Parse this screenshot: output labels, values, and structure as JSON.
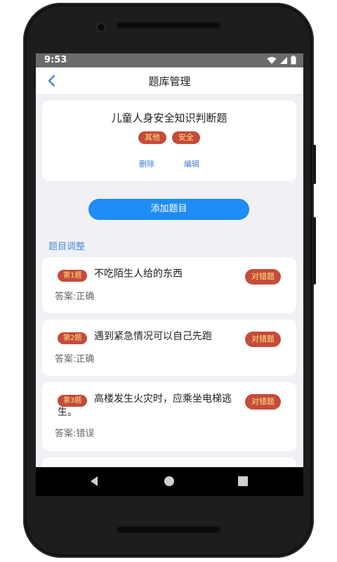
{
  "status_bar": {
    "time": "9:53"
  },
  "navbar": {
    "title": "题库管理"
  },
  "bank": {
    "title": "儿童人身安全知识判断题",
    "tags": [
      "其他",
      "安全"
    ],
    "delete_label": "删除",
    "edit_label": "编辑"
  },
  "add_button_label": "添加题目",
  "section_label": "题目调整",
  "questions": [
    {
      "badge": "第1题",
      "text": "不吃陌生人给的东西",
      "type": "对错题",
      "answer": "答案:正确"
    },
    {
      "badge": "第2题",
      "text": "遇到紧急情况可以自己先跑",
      "type": "对错题",
      "answer": "答案:正确"
    },
    {
      "badge": "第3题",
      "text": "高楼发生火灾时，应乘坐电梯逃生。",
      "type": "对错题",
      "answer": "答案:错误"
    }
  ],
  "colors": {
    "accent": "#1e8cf5",
    "badge_bg": "#c54b3c",
    "badge_text": "#ffe27a"
  }
}
